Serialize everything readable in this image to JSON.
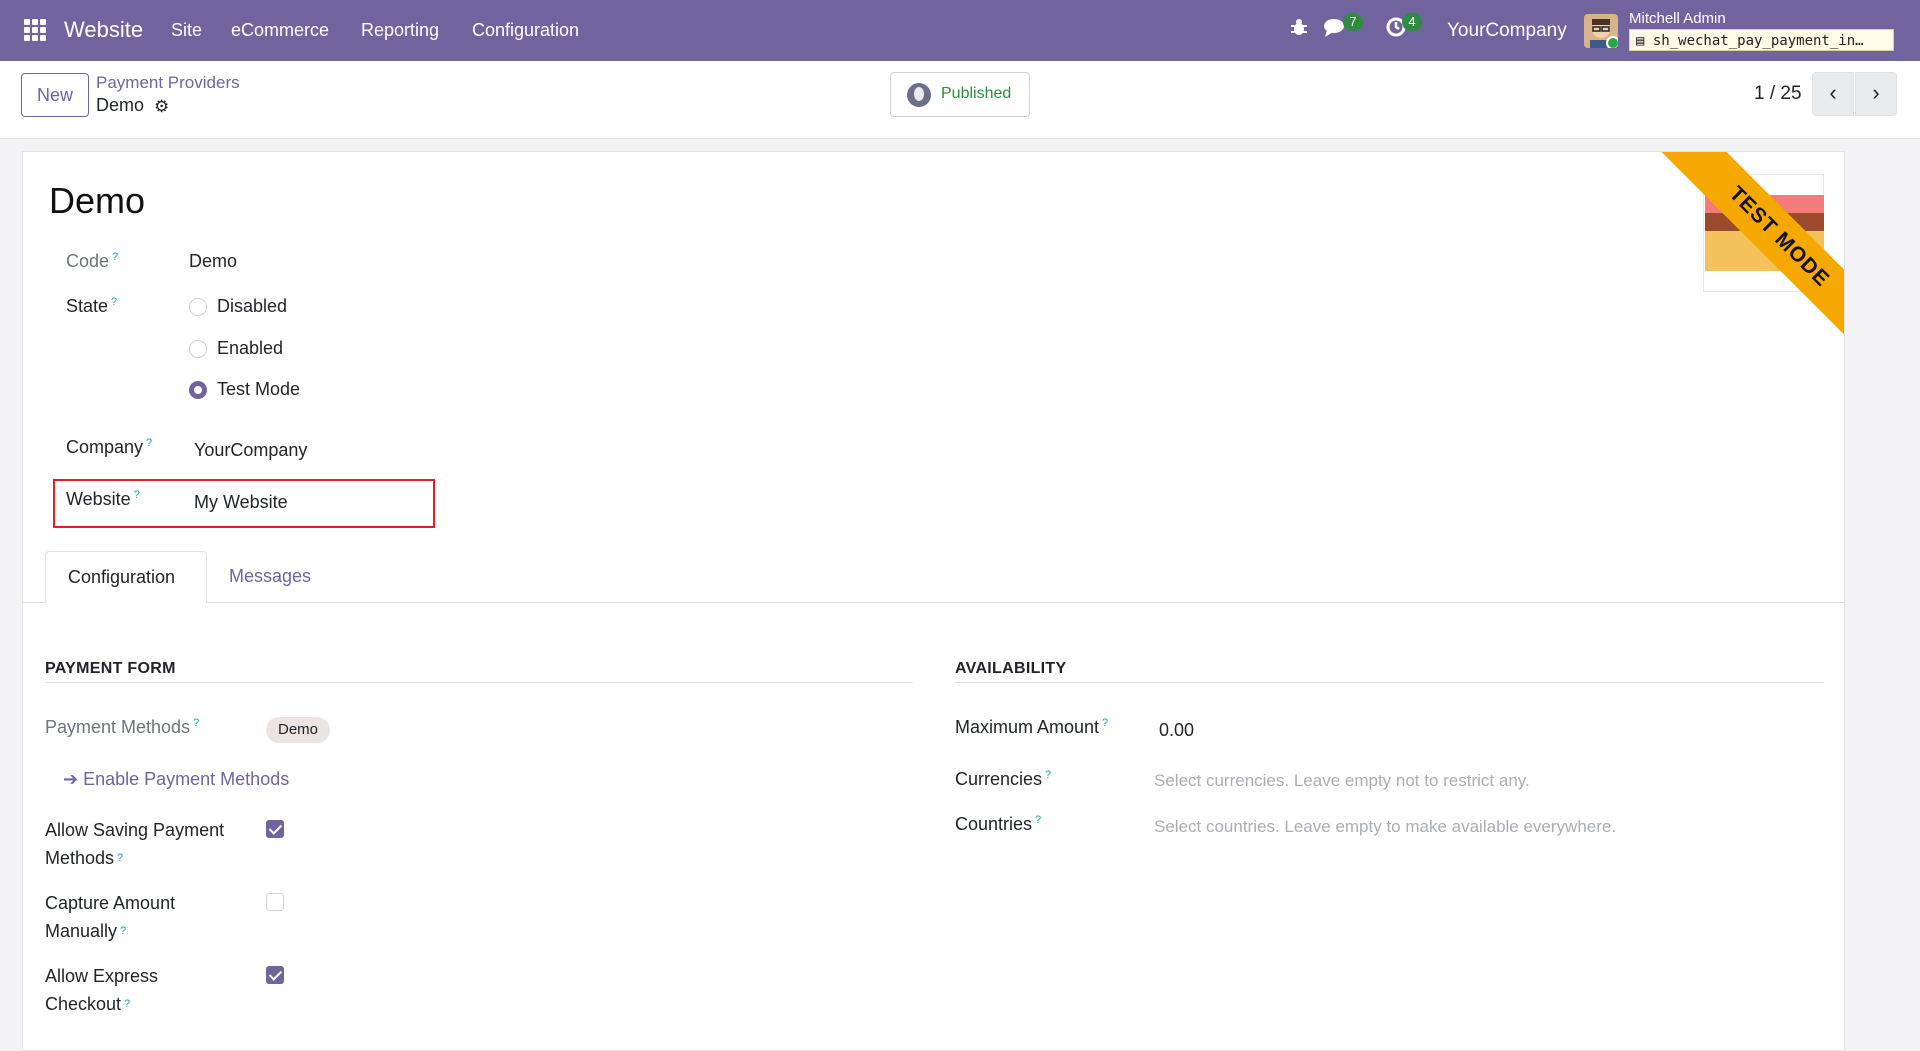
{
  "navbar": {
    "brand": "Website",
    "menus": [
      "Site",
      "eCommerce",
      "Reporting",
      "Configuration"
    ],
    "messages_count": "7",
    "activities_count": "4",
    "company": "YourCompany",
    "user_name": "Mitchell Admin",
    "database": "sh_wechat_pay_payment_in…",
    "bg_color": "#71639e"
  },
  "control_panel": {
    "new_label": "New",
    "breadcrumb_parent": "Payment Providers",
    "breadcrumb_current": "Demo",
    "published_label": "Published",
    "pager": "1 / 25"
  },
  "record": {
    "title": "Demo",
    "ribbon": "TEST MODE",
    "code_label": "Code",
    "code_value": "Demo",
    "state_label": "State",
    "state_options": [
      "Disabled",
      "Enabled",
      "Test Mode"
    ],
    "state_selected": "Test Mode",
    "company_label": "Company",
    "company_value": "YourCompany",
    "website_label": "Website",
    "website_value": "My Website"
  },
  "tabs": [
    "Configuration",
    "Messages"
  ],
  "payment_form": {
    "title": "PAYMENT FORM",
    "methods_label": "Payment Methods",
    "methods_tag": "Demo",
    "enable_link": "Enable Payment Methods",
    "allow_saving_label_1": "Allow Saving Payment",
    "allow_saving_label_2": "Methods",
    "allow_saving_checked": true,
    "capture_label_1": "Capture Amount",
    "capture_label_2": "Manually",
    "capture_checked": false,
    "express_label_1": "Allow Express",
    "express_label_2": "Checkout",
    "express_checked": true
  },
  "availability": {
    "title": "AVAILABILITY",
    "max_amount_label": "Maximum Amount",
    "max_amount_value": "0.00",
    "currencies_label": "Currencies",
    "currencies_placeholder": "Select currencies. Leave empty not to restrict any.",
    "countries_label": "Countries",
    "countries_placeholder": "Select countries. Leave empty to make available everywhere."
  },
  "colors": {
    "accent": "#71639e",
    "published": "#2e8b3f",
    "ribbon": "#f5a800",
    "highlight": "#e0212d"
  }
}
